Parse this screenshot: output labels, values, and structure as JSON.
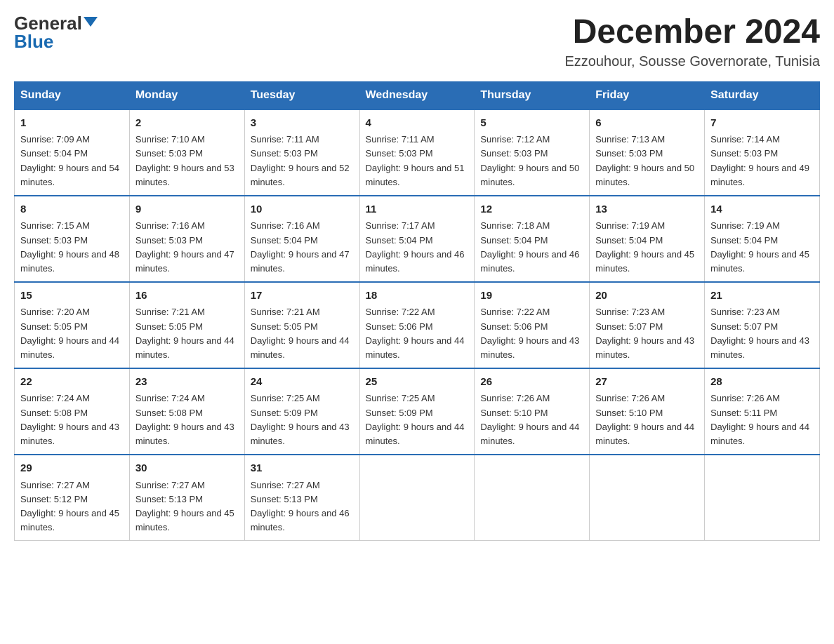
{
  "logo": {
    "general": "General",
    "blue": "Blue"
  },
  "title": {
    "month": "December 2024",
    "location": "Ezzouhour, Sousse Governorate, Tunisia"
  },
  "headers": [
    "Sunday",
    "Monday",
    "Tuesday",
    "Wednesday",
    "Thursday",
    "Friday",
    "Saturday"
  ],
  "weeks": [
    [
      {
        "day": "1",
        "sunrise": "7:09 AM",
        "sunset": "5:04 PM",
        "daylight": "9 hours and 54 minutes."
      },
      {
        "day": "2",
        "sunrise": "7:10 AM",
        "sunset": "5:03 PM",
        "daylight": "9 hours and 53 minutes."
      },
      {
        "day": "3",
        "sunrise": "7:11 AM",
        "sunset": "5:03 PM",
        "daylight": "9 hours and 52 minutes."
      },
      {
        "day": "4",
        "sunrise": "7:11 AM",
        "sunset": "5:03 PM",
        "daylight": "9 hours and 51 minutes."
      },
      {
        "day": "5",
        "sunrise": "7:12 AM",
        "sunset": "5:03 PM",
        "daylight": "9 hours and 50 minutes."
      },
      {
        "day": "6",
        "sunrise": "7:13 AM",
        "sunset": "5:03 PM",
        "daylight": "9 hours and 50 minutes."
      },
      {
        "day": "7",
        "sunrise": "7:14 AM",
        "sunset": "5:03 PM",
        "daylight": "9 hours and 49 minutes."
      }
    ],
    [
      {
        "day": "8",
        "sunrise": "7:15 AM",
        "sunset": "5:03 PM",
        "daylight": "9 hours and 48 minutes."
      },
      {
        "day": "9",
        "sunrise": "7:16 AM",
        "sunset": "5:03 PM",
        "daylight": "9 hours and 47 minutes."
      },
      {
        "day": "10",
        "sunrise": "7:16 AM",
        "sunset": "5:04 PM",
        "daylight": "9 hours and 47 minutes."
      },
      {
        "day": "11",
        "sunrise": "7:17 AM",
        "sunset": "5:04 PM",
        "daylight": "9 hours and 46 minutes."
      },
      {
        "day": "12",
        "sunrise": "7:18 AM",
        "sunset": "5:04 PM",
        "daylight": "9 hours and 46 minutes."
      },
      {
        "day": "13",
        "sunrise": "7:19 AM",
        "sunset": "5:04 PM",
        "daylight": "9 hours and 45 minutes."
      },
      {
        "day": "14",
        "sunrise": "7:19 AM",
        "sunset": "5:04 PM",
        "daylight": "9 hours and 45 minutes."
      }
    ],
    [
      {
        "day": "15",
        "sunrise": "7:20 AM",
        "sunset": "5:05 PM",
        "daylight": "9 hours and 44 minutes."
      },
      {
        "day": "16",
        "sunrise": "7:21 AM",
        "sunset": "5:05 PM",
        "daylight": "9 hours and 44 minutes."
      },
      {
        "day": "17",
        "sunrise": "7:21 AM",
        "sunset": "5:05 PM",
        "daylight": "9 hours and 44 minutes."
      },
      {
        "day": "18",
        "sunrise": "7:22 AM",
        "sunset": "5:06 PM",
        "daylight": "9 hours and 44 minutes."
      },
      {
        "day": "19",
        "sunrise": "7:22 AM",
        "sunset": "5:06 PM",
        "daylight": "9 hours and 43 minutes."
      },
      {
        "day": "20",
        "sunrise": "7:23 AM",
        "sunset": "5:07 PM",
        "daylight": "9 hours and 43 minutes."
      },
      {
        "day": "21",
        "sunrise": "7:23 AM",
        "sunset": "5:07 PM",
        "daylight": "9 hours and 43 minutes."
      }
    ],
    [
      {
        "day": "22",
        "sunrise": "7:24 AM",
        "sunset": "5:08 PM",
        "daylight": "9 hours and 43 minutes."
      },
      {
        "day": "23",
        "sunrise": "7:24 AM",
        "sunset": "5:08 PM",
        "daylight": "9 hours and 43 minutes."
      },
      {
        "day": "24",
        "sunrise": "7:25 AM",
        "sunset": "5:09 PM",
        "daylight": "9 hours and 43 minutes."
      },
      {
        "day": "25",
        "sunrise": "7:25 AM",
        "sunset": "5:09 PM",
        "daylight": "9 hours and 44 minutes."
      },
      {
        "day": "26",
        "sunrise": "7:26 AM",
        "sunset": "5:10 PM",
        "daylight": "9 hours and 44 minutes."
      },
      {
        "day": "27",
        "sunrise": "7:26 AM",
        "sunset": "5:10 PM",
        "daylight": "9 hours and 44 minutes."
      },
      {
        "day": "28",
        "sunrise": "7:26 AM",
        "sunset": "5:11 PM",
        "daylight": "9 hours and 44 minutes."
      }
    ],
    [
      {
        "day": "29",
        "sunrise": "7:27 AM",
        "sunset": "5:12 PM",
        "daylight": "9 hours and 45 minutes."
      },
      {
        "day": "30",
        "sunrise": "7:27 AM",
        "sunset": "5:13 PM",
        "daylight": "9 hours and 45 minutes."
      },
      {
        "day": "31",
        "sunrise": "7:27 AM",
        "sunset": "5:13 PM",
        "daylight": "9 hours and 46 minutes."
      },
      null,
      null,
      null,
      null
    ]
  ],
  "labels": {
    "sunrise": "Sunrise: ",
    "sunset": "Sunset: ",
    "daylight": "Daylight: "
  }
}
